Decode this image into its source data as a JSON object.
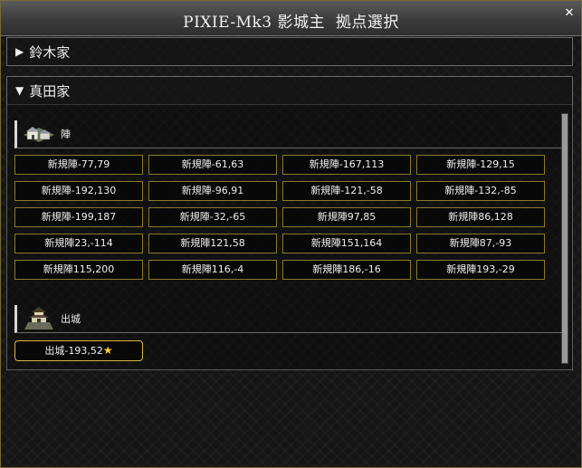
{
  "window": {
    "title": "PIXIE-Mk3 影城主  拠点選択",
    "close_glyph": "✕"
  },
  "sections": [
    {
      "arrow": "▶",
      "label": "鈴木家"
    },
    {
      "arrow": "▼",
      "label": "真田家"
    }
  ],
  "camp": {
    "label": "陣",
    "icon": "camp-icon",
    "buttons": [
      "新規陣-77,79",
      "新規陣-61,63",
      "新規陣-167,113",
      "新規陣-129,15",
      "新規陣-192,130",
      "新規陣-96,91",
      "新規陣-121,-58",
      "新規陣-132,-85",
      "新規陣-199,187",
      "新規陣-32,-65",
      "新規陣97,85",
      "新規陣86,128",
      "新規陣23,-114",
      "新規陣121,58",
      "新規陣151,164",
      "新規陣87,-93",
      "新規陣115,200",
      "新規陣116,-4",
      "新規陣186,-16",
      "新規陣193,-29"
    ]
  },
  "castle": {
    "label": "出城",
    "icon": "castle-icon",
    "button": "出城-193,52",
    "star": "★",
    "accent": "#ffd21a"
  },
  "colors": {
    "button_border": "#8a7a2a",
    "selected_border": "#d8b840"
  }
}
